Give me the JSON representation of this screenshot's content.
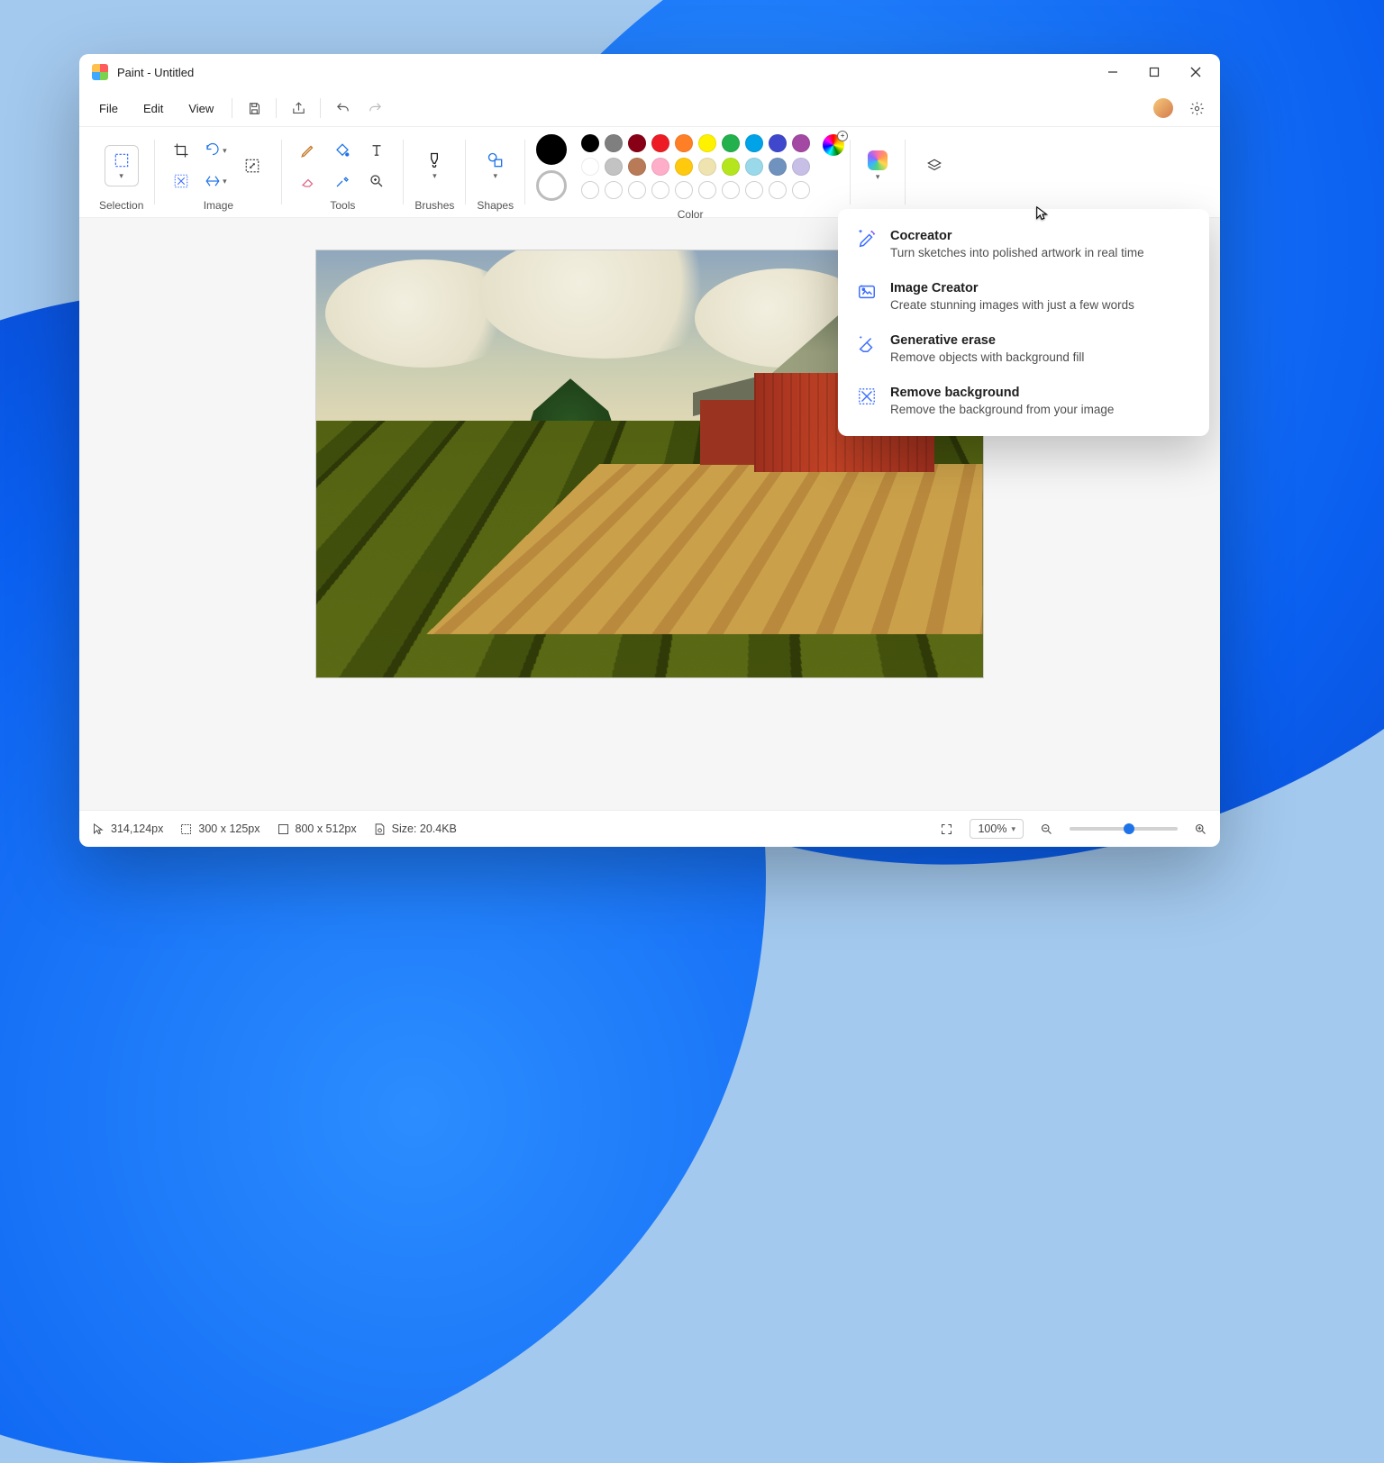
{
  "window": {
    "title": "Paint - Untitled"
  },
  "menu": {
    "file": "File",
    "edit": "Edit",
    "view": "View"
  },
  "ribbon": {
    "groups": {
      "selection": "Selection",
      "image": "Image",
      "tools": "Tools",
      "brushes": "Brushes",
      "shapes": "Shapes",
      "color": "Color"
    }
  },
  "colors": {
    "current": "#000000",
    "secondary": "#ffffff",
    "row1": [
      "#000000",
      "#7f7f7f",
      "#880015",
      "#ed1c24",
      "#ff7f27",
      "#fff200",
      "#22b14c",
      "#00a2e8",
      "#3f48cc",
      "#a349a4"
    ],
    "row2": [
      "#ffffff",
      "#c3c3c3",
      "#b97a57",
      "#ffaec9",
      "#ffc90e",
      "#efe4b0",
      "#b5e61d",
      "#99d9ea",
      "#7092be",
      "#c8bfe7"
    ]
  },
  "dropdown": [
    {
      "title": "Cocreator",
      "desc": "Turn sketches into polished artwork in real time"
    },
    {
      "title": "Image Creator",
      "desc": "Create stunning images with just a few words"
    },
    {
      "title": "Generative erase",
      "desc": "Remove objects with background fill"
    },
    {
      "title": "Remove background",
      "desc": "Remove the background from your image"
    }
  ],
  "status": {
    "cursor_pos": "314,124px",
    "selection_size": "300  x  125px",
    "canvas_size": "800  x  512px",
    "file_size": "Size: 20.4KB",
    "zoom": "100%"
  }
}
